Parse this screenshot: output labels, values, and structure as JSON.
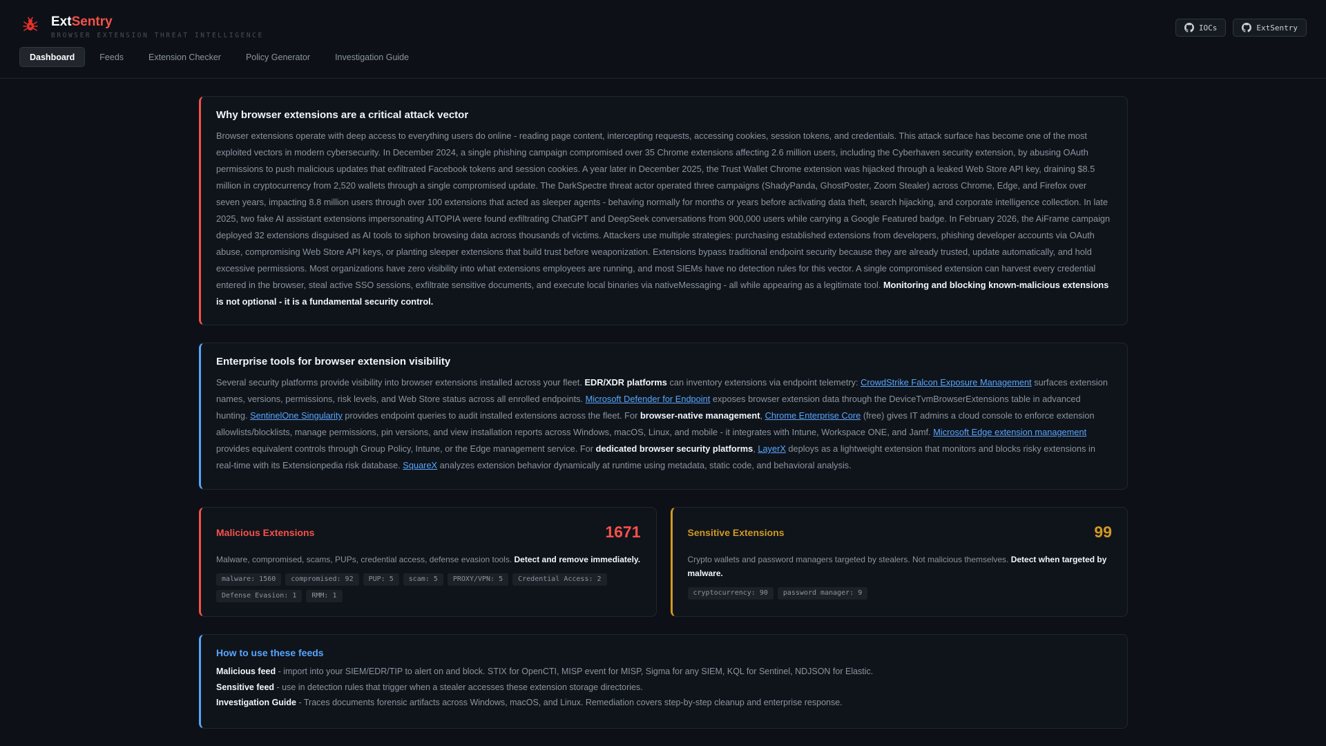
{
  "brand": {
    "name_prefix": "Ext",
    "name_suffix": "Sentry",
    "tagline": "BROWSER EXTENSION THREAT INTELLIGENCE",
    "logo_icon": "spider-bug-icon",
    "accent": "#f85149"
  },
  "top_actions": [
    {
      "label": "IOCs",
      "icon": "github-icon"
    },
    {
      "label": "ExtSentry",
      "icon": "github-icon"
    }
  ],
  "nav": {
    "tabs": [
      {
        "label": "Dashboard",
        "active": true
      },
      {
        "label": "Feeds",
        "active": false
      },
      {
        "label": "Extension Checker",
        "active": false
      },
      {
        "label": "Policy Generator",
        "active": false
      },
      {
        "label": "Investigation Guide",
        "active": false
      }
    ]
  },
  "intro": {
    "title": "Why browser extensions are a critical attack vector",
    "body": "Browser extensions operate with deep access to everything users do online - reading page content, intercepting requests, accessing cookies, session tokens, and credentials. This attack surface has become one of the most exploited vectors in modern cybersecurity. In December 2024, a single phishing campaign compromised over 35 Chrome extensions affecting 2.6 million users, including the Cyberhaven security extension, by abusing OAuth permissions to push malicious updates that exfiltrated Facebook tokens and session cookies. A year later in December 2025, the Trust Wallet Chrome extension was hijacked through a leaked Web Store API key, draining $8.5 million in cryptocurrency from 2,520 wallets through a single compromised update. The DarkSpectre threat actor operated three campaigns (ShadyPanda, GhostPoster, Zoom Stealer) across Chrome, Edge, and Firefox over seven years, impacting 8.8 million users through over 100 extensions that acted as sleeper agents - behaving normally for months or years before activating data theft, search hijacking, and corporate intelligence collection. In late 2025, two fake AI assistant extensions impersonating AITOPIA were found exfiltrating ChatGPT and DeepSeek conversations from 900,000 users while carrying a Google Featured badge. In February 2026, the AiFrame campaign deployed 32 extensions disguised as AI tools to siphon browsing data across thousands of victims. Attackers use multiple strategies: purchasing established extensions from developers, phishing developer accounts via OAuth abuse, compromising Web Store API keys, or planting sleeper extensions that build trust before weaponization. Extensions bypass traditional endpoint security because they are already trusted, update automatically, and hold excessive permissions. Most organizations have zero visibility into what extensions employees are running, and most SIEMs have no detection rules for this vector. A single compromised extension can harvest every credential entered in the browser, steal active SSO sessions, exfiltrate sensitive documents, and execute local binaries via nativeMessaging - all while appearing as a legitimate tool. ",
    "emphasis": "Monitoring and blocking known-malicious extensions is not optional - it is a fundamental security control."
  },
  "tools": {
    "title": "Enterprise tools for browser extension visibility",
    "t1": "Several security platforms provide visibility into browser extensions installed across your fleet. ",
    "b1": "EDR/XDR platforms",
    "t2": " can inventory extensions via endpoint telemetry: ",
    "l1": "CrowdStrike Falcon Exposure Management",
    "t3": " surfaces extension names, versions, permissions, risk levels, and Web Store status across all enrolled endpoints. ",
    "l2": "Microsoft Defender for Endpoint",
    "t4": " exposes browser extension data through the DeviceTvmBrowserExtensions table in advanced hunting. ",
    "l3": "SentinelOne Singularity",
    "t5": " provides endpoint queries to audit installed extensions across the fleet. For ",
    "b2": "browser-native management",
    "t6": ", ",
    "l4": "Chrome Enterprise Core",
    "t7": " (free) gives IT admins a cloud console to enforce extension allowlists/blocklists, manage permissions, pin versions, and view installation reports across Windows, macOS, Linux, and mobile - it integrates with Intune, Workspace ONE, and Jamf. ",
    "l5": "Microsoft Edge extension management",
    "t8": " provides equivalent controls through Group Policy, Intune, or the Edge management service. For ",
    "b3": "dedicated browser security platforms",
    "t9": ", ",
    "l6": "LayerX",
    "t10": " deploys as a lightweight extension that monitors and blocks risky extensions in real-time with its Extensionpedia risk database. ",
    "l7": "SquareX",
    "t11": " analyzes extension behavior dynamically at runtime using metadata, static code, and behavioral analysis."
  },
  "malicious": {
    "title": "Malicious Extensions",
    "count": "1671",
    "desc": "Malware, compromised, scams, PUPs, credential access, defense evasion tools. ",
    "emphasis": "Detect and remove immediately.",
    "tags": [
      "malware: 1560",
      "compromised: 92",
      "PUP: 5",
      "scam: 5",
      "PROXY/VPN: 5",
      "Credential Access: 2",
      "Defense Evasion: 1",
      "RMM: 1"
    ],
    "color": "#f85149"
  },
  "sensitive": {
    "title": "Sensitive Extensions",
    "count": "99",
    "desc": "Crypto wallets and password managers targeted by stealers. Not malicious themselves. ",
    "emphasis": "Detect when targeted by malware.",
    "tags": [
      "cryptocurrency: 90",
      "password manager: 9"
    ],
    "color": "#d29922"
  },
  "howto": {
    "title": "How to use these feeds",
    "lines": [
      {
        "label": "Malicious feed",
        "text": " - import into your SIEM/EDR/TIP to alert on and block. STIX for OpenCTI, MISP event for MISP, Sigma for any SIEM, KQL for Sentinel, NDJSON for Elastic."
      },
      {
        "label": "Sensitive feed",
        "text": " - use in detection rules that trigger when a stealer accesses these extension storage directories."
      },
      {
        "label": "Investigation Guide",
        "text": " - Traces documents forensic artifacts across Windows, macOS, and Linux. Remediation covers step-by-step cleanup and enterprise response."
      }
    ]
  }
}
